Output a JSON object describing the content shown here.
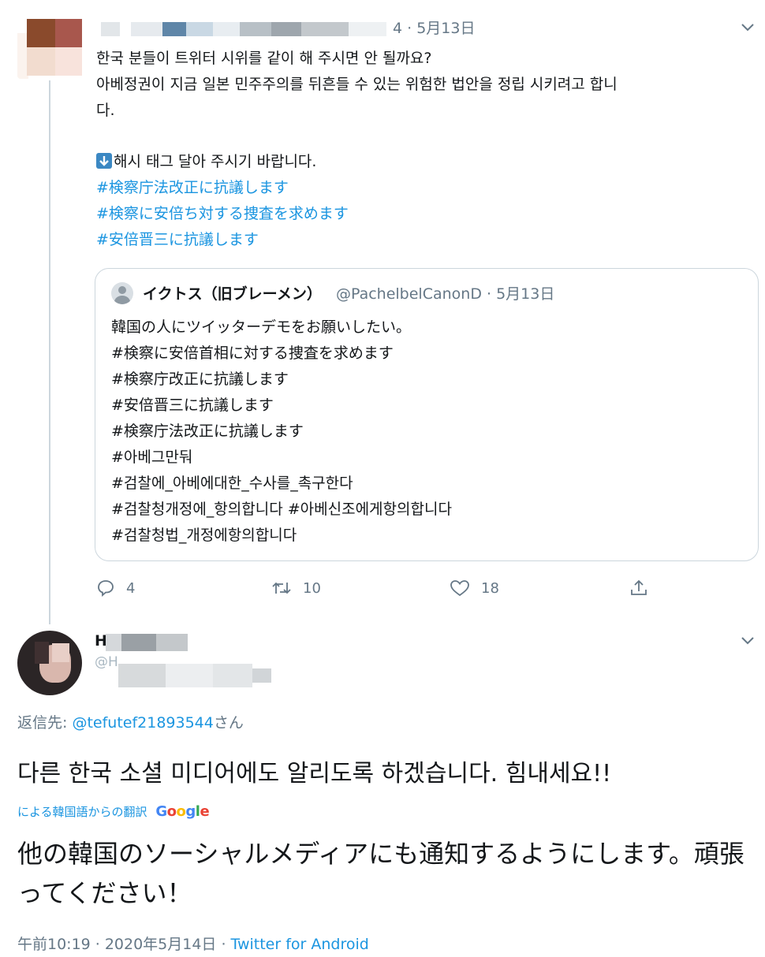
{
  "tweet1": {
    "header_time": "4 · 5月13日",
    "lines": [
      "한국 분들이 트위터 시위를 같이 해 주시면 안 될까요?",
      "아베정권이 지금 일본 민주주의를 뒤흔들 수 있는 위험한 법안을 정립 시키려고 합니",
      "다."
    ],
    "request": "해시 태그 달아 주시기 바랍니다.",
    "hashtags": [
      "#検察庁法改正に抗議します",
      "#検察に安倍ち対する捜査を求めます",
      "#安倍晋三に抗議します"
    ],
    "quote": {
      "name": "イクトス（旧ブレーメン）",
      "handle_time": "@PachelbelCanonD · 5月13日",
      "lines": [
        "韓国の人にツイッターデモをお願いしたい。",
        "#検察に安倍首相に対する捜査を求めます",
        "#検察庁改正に抗議します",
        "#安倍晋三に抗議します",
        "#検察庁法改正に抗議します",
        "#아베그만둬",
        "#검찰에_아베에대한_수사를_촉구한다",
        "#검찰청개정에_항의합니다 #아베신조에게항의합니다",
        "#검찰청법_개정에항의합니다"
      ]
    },
    "actions": {
      "replies": "4",
      "retweets": "10",
      "likes": "18"
    }
  },
  "tweet2": {
    "name_partial": "H",
    "handle_partial": "@H",
    "reply_prefix": "返信先: ",
    "reply_handle": "@tefutef21893544",
    "reply_suffix": "さん",
    "text": "다른 한국 소셜 미디어에도 알리도록 하겠습니다. 힘내세요!!",
    "translation_label": "による韓国語からの翻訳",
    "translation_provider": "Google",
    "translated": "他の韓国のソーシャルメディアにも通知するようにします。頑張ってください！",
    "time": "午前10:19",
    "date": "2020年5月14日",
    "source": "Twitter for Android"
  },
  "colors": {
    "link": "#1b95e0",
    "muted": "#657786",
    "border": "#ccd6dd"
  },
  "icons": [
    "chevron-down-icon",
    "down-arrow-emoji-icon",
    "reply-icon",
    "retweet-icon",
    "like-icon",
    "share-icon",
    "avatar"
  ]
}
